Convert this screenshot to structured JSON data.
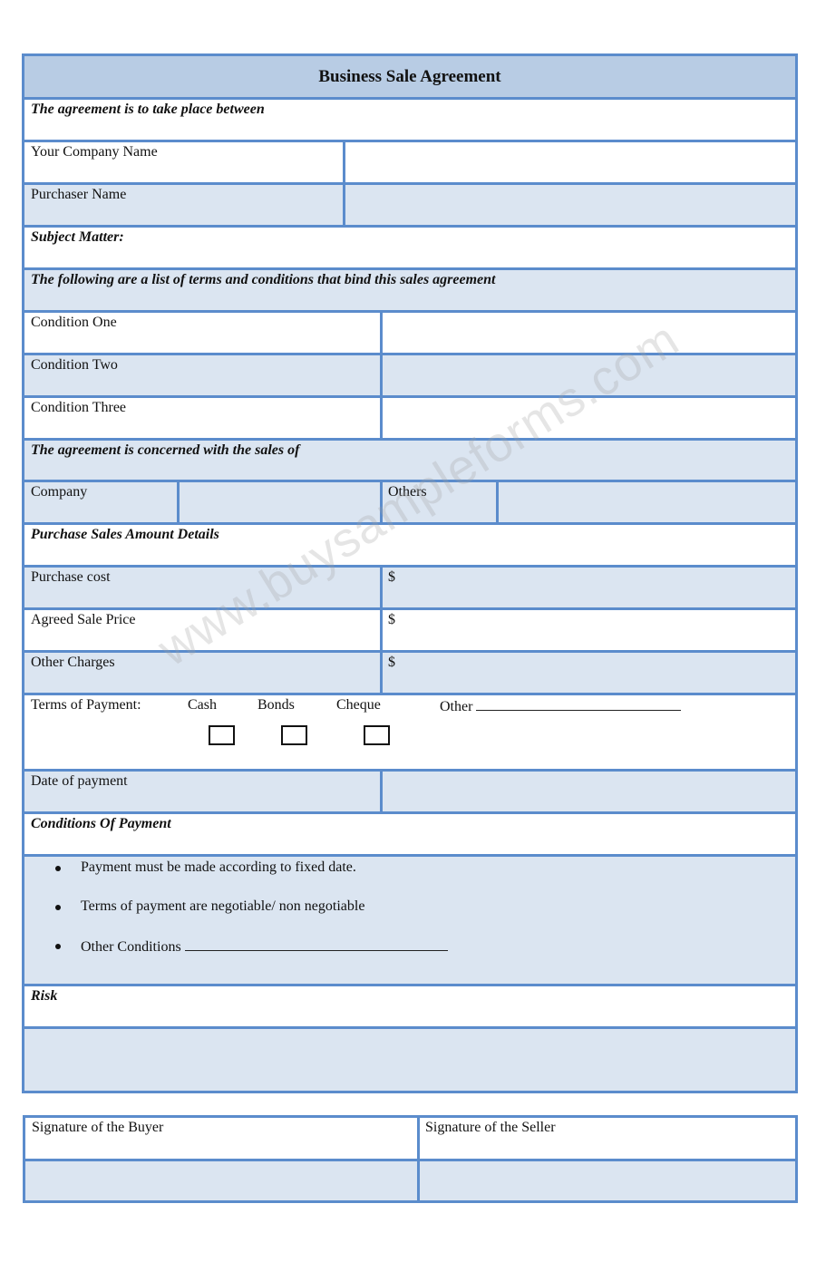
{
  "title": "Business Sale Agreement",
  "sections": {
    "parties_heading": "The agreement is to take place between",
    "your_company_label": "Your Company Name",
    "purchaser_label": "Purchaser Name",
    "subject_matter": "Subject Matter:",
    "terms_heading": "The following are a list of terms and conditions that bind this sales agreement",
    "conditions": [
      "Condition One",
      "Condition Two",
      "Condition Three"
    ],
    "sales_heading": "The agreement is concerned with the sales of",
    "company_label": "Company",
    "others_label": "Others",
    "amount_heading": "Purchase Sales Amount Details",
    "amounts": [
      {
        "label": "Purchase cost",
        "currency": "$"
      },
      {
        "label": "Agreed Sale Price",
        "currency": "$"
      },
      {
        "label": "Other Charges",
        "currency": "$"
      }
    ],
    "terms_of_payment": {
      "label": "Terms of Payment:",
      "options": [
        "Cash",
        "Bonds",
        "Cheque"
      ],
      "other_label": "Other"
    },
    "date_of_payment": "Date of payment",
    "conditions_of_payment_heading": "Conditions Of Payment",
    "payment_conditions": [
      "Payment must be made according to fixed date.",
      "Terms of payment are negotiable/ non negotiable",
      "Other Conditions"
    ],
    "risk_heading": "Risk"
  },
  "signatures": {
    "buyer": "Signature of the Buyer",
    "seller": "Signature of the Seller"
  },
  "watermark": "www.buysampleforms.com",
  "colors": {
    "border": "#5b8ccc",
    "header_fill": "#b8cce4",
    "band_fill": "#dbe5f1"
  }
}
